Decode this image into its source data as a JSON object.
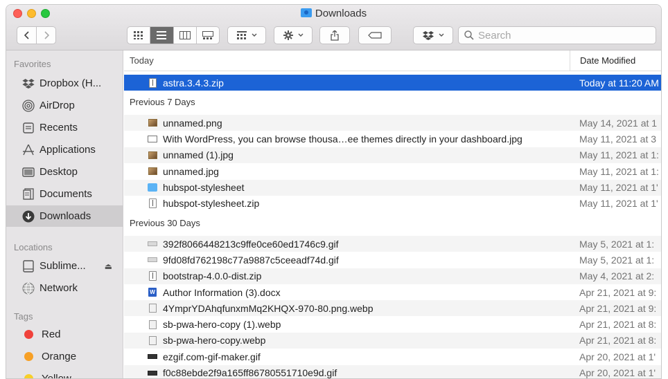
{
  "window": {
    "title": "Downloads"
  },
  "toolbar": {
    "back_icon": "chevron-left-icon",
    "forward_icon": "chevron-right-icon",
    "view_modes": [
      "icon-view",
      "list-view",
      "column-view",
      "gallery-view"
    ],
    "active_view": "list-view",
    "search_placeholder": "Search"
  },
  "sidebar": {
    "favorites_header": "Favorites",
    "favorites": [
      {
        "label": "Dropbox (H...",
        "icon": "dropbox-icon"
      },
      {
        "label": "AirDrop",
        "icon": "airdrop-icon"
      },
      {
        "label": "Recents",
        "icon": "recents-icon"
      },
      {
        "label": "Applications",
        "icon": "applications-icon"
      },
      {
        "label": "Desktop",
        "icon": "desktop-icon"
      },
      {
        "label": "Documents",
        "icon": "documents-icon"
      },
      {
        "label": "Downloads",
        "icon": "downloads-icon",
        "selected": true
      }
    ],
    "locations_header": "Locations",
    "locations": [
      {
        "label": "Sublime...",
        "icon": "disk-icon"
      },
      {
        "label": "Network",
        "icon": "network-icon"
      }
    ],
    "tags_header": "Tags",
    "tags": [
      {
        "label": "Red",
        "color": "#f0413b"
      },
      {
        "label": "Orange",
        "color": "#f7a026"
      },
      {
        "label": "Yellow",
        "color": "#f7cf2a"
      }
    ]
  },
  "columns": {
    "name": "Today",
    "date": "Date Modified"
  },
  "groups": {
    "today": "Today",
    "prev7": "Previous 7 Days",
    "prev30": "Previous 30 Days"
  },
  "files": {
    "today": [
      {
        "name": "astra.3.4.3.zip",
        "date": "Today at 11:20 AM",
        "type": "zip"
      }
    ],
    "prev7": [
      {
        "name": "unnamed.png",
        "date": "May 14, 2021 at 1",
        "type": "img"
      },
      {
        "name": "With WordPress, you can browse thousa…ee themes directly in your dashboard.jpg",
        "date": "May 11, 2021 at 3",
        "type": "wide"
      },
      {
        "name": "unnamed (1).jpg",
        "date": "May 11, 2021 at 1:",
        "type": "img"
      },
      {
        "name": "unnamed.jpg",
        "date": "May 11, 2021 at 1:",
        "type": "img"
      },
      {
        "name": "hubspot-stylesheet",
        "date": "May 11, 2021 at 1'",
        "type": "folder"
      },
      {
        "name": "hubspot-stylesheet.zip",
        "date": "May 11, 2021 at 1'",
        "type": "zip"
      }
    ],
    "prev30": [
      {
        "name": "392f8066448213c9ffe0ce60ed1746c9.gif",
        "date": "May 5, 2021 at 1:",
        "type": "gif"
      },
      {
        "name": "9fd08fd762198c77a9887c5ceeadf74d.gif",
        "date": "May 5, 2021 at 1:",
        "type": "gif"
      },
      {
        "name": "bootstrap-4.0.0-dist.zip",
        "date": "May 4, 2021 at 2:",
        "type": "zip"
      },
      {
        "name": "Author Information (3).docx",
        "date": "Apr 21, 2021 at 9:",
        "type": "word"
      },
      {
        "name": "4YmprYDAhqfunxmMq2KHQX-970-80.png.webp",
        "date": "Apr 21, 2021 at 9:",
        "type": "webp"
      },
      {
        "name": "sb-pwa-hero-copy (1).webp",
        "date": "Apr 21, 2021 at 8:",
        "type": "webp"
      },
      {
        "name": "sb-pwa-hero-copy.webp",
        "date": "Apr 21, 2021 at 8:",
        "type": "webp"
      },
      {
        "name": "ezgif.com-gif-maker.gif",
        "date": "Apr 20, 2021 at 1'",
        "type": "dark"
      },
      {
        "name": "f0c88ebde2f9a165ff86780551710e9d.gif",
        "date": "Apr 20, 2021 at 1'",
        "type": "dark"
      }
    ]
  }
}
